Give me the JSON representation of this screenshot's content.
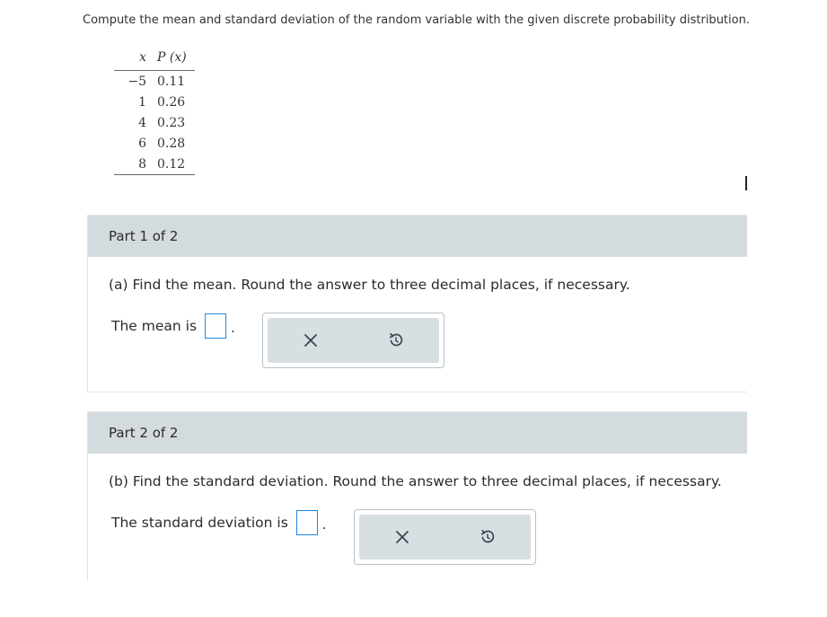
{
  "question": "Compute the mean and standard deviation of the random variable with the given discrete probability distribution.",
  "table": {
    "col_x": "x",
    "col_p": "P (x)",
    "rows": [
      {
        "x": "−5",
        "p": "0.11"
      },
      {
        "x": "1",
        "p": "0.26"
      },
      {
        "x": "4",
        "p": "0.23"
      },
      {
        "x": "6",
        "p": "0.28"
      },
      {
        "x": "8",
        "p": "0.12"
      }
    ]
  },
  "part1": {
    "header": "Part 1 of 2",
    "instruction": "(a) Find the mean. Round the answer to three decimal places, if necessary.",
    "answer_label": "The mean is",
    "answer_value": "",
    "period": ".",
    "clear_icon": "x-icon",
    "undo_icon": "undo-icon"
  },
  "part2": {
    "header": "Part 2 of 2",
    "instruction": "(b) Find the standard deviation. Round the answer to three decimal places, if necessary.",
    "answer_label": "The standard deviation is",
    "answer_value": "",
    "period": ".",
    "clear_icon": "x-icon",
    "undo_icon": "undo-icon"
  },
  "colors": {
    "header_bg": "#d4dbdf",
    "tool_bg": "#d8dfe3",
    "input_border": "#1e88e5",
    "icon": "#3a4650"
  }
}
